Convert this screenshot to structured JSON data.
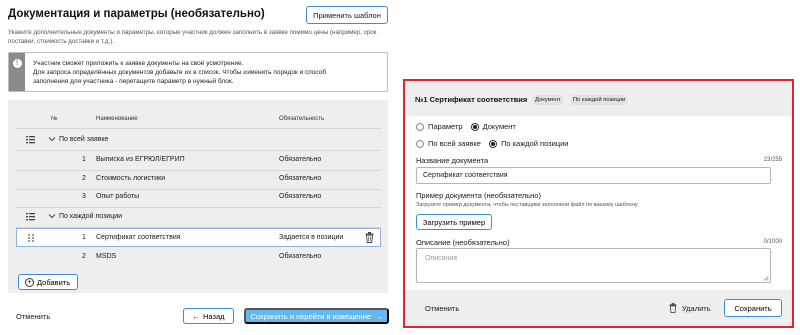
{
  "header": {
    "title": "Документация и параметры (необязательно)",
    "apply_template_label": "Применить шаблон",
    "subtitle": "Укажите дополнительные документы и параметры, которые участник должен заполнить в заявке помимо цены (например, срок поставки, стоимость доставки и т.д.)."
  },
  "info": {
    "icon": "info-icon",
    "line1": "Участник сможет приложить к заявке документы на своё усмотрение.",
    "line2": "Для запроса определённых документов добавьте их в список. Чтобы изменить порядок и способ",
    "line3": "заполнения для участника - перетащите параметр в нужный блок."
  },
  "table": {
    "col_num": "№",
    "col_name": "Наименование",
    "col_req": "Обязательность",
    "group1_label": "По всей заявке",
    "group1_rows": [
      {
        "num": "1",
        "name": "Выписка из ЕГРЮЛ/ЕГРИП",
        "req": "Обязательно"
      },
      {
        "num": "2",
        "name": "Стоимость логистики",
        "req": "Обязательно"
      },
      {
        "num": "3",
        "name": "Опыт работы",
        "req": "Обязательно"
      }
    ],
    "group2_label": "По каждой позиции",
    "group2_rows": [
      {
        "num": "1",
        "name": "Сертификат соответствия",
        "req": "Задается в позиции"
      },
      {
        "num": "2",
        "name": "MSDS",
        "req": "Обязательно"
      }
    ],
    "add_label": "Добавить"
  },
  "footer": {
    "cancel_label": "Отменить",
    "back_label": "Назад",
    "save_go_label": "Сохранить и перейти в извещение"
  },
  "editor": {
    "title": "№1 Сертификат соответствия",
    "tag1": "Документ",
    "tag2": "По каждой позиции",
    "radio_param": "Параметр",
    "radio_doc": "Документ",
    "radio_all": "По всей заявке",
    "radio_each": "По каждой позиции",
    "name_label": "Название документа",
    "name_counter": "23/255",
    "name_value": "Сертификат соответствия",
    "example_label": "Пример документа (необязательно)",
    "example_hint": "Загрузите пример документа, чтобы поставщики заполнили файл по вашему шаблону",
    "upload_label": "Загрузить пример",
    "desc_label": "Описание (необязательно)",
    "desc_counter": "0/1000",
    "desc_placeholder": "Описание",
    "cancel_label": "Отменить",
    "delete_label": "Удалить",
    "save_label": "Сохранить"
  },
  "colors": {
    "accent": "#3b8fd9",
    "primary_fill": "#62b9f2",
    "highlight_border": "#e0262b",
    "panel_bg": "#eeeeee"
  }
}
